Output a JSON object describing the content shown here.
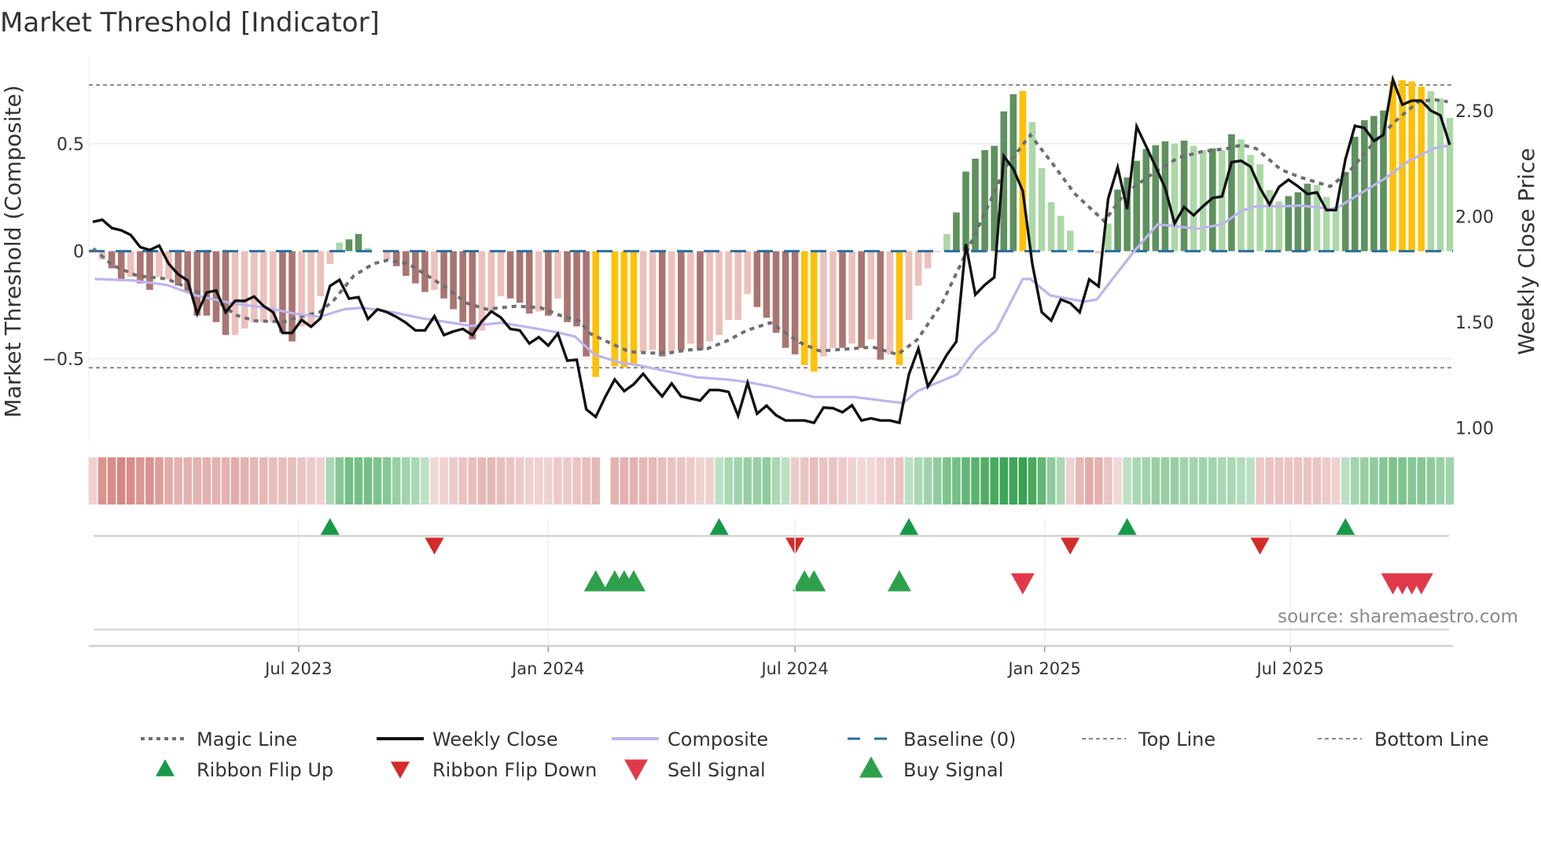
{
  "chart_data": {
    "type": "bar",
    "title": "Market Threshold [Indicator]",
    "ylabel": "Market Threshold (Composite)",
    "y2label": "Weekly Close Price",
    "xlabel": "",
    "ylim": [
      -0.886,
      0.872
    ],
    "y2lim": [
      0.935,
      2.722
    ],
    "yticks": [
      {
        "v": 0.5,
        "label": "0.5"
      },
      {
        "v": 0,
        "label": "0"
      },
      {
        "v": -0.5,
        "label": "−0.5"
      }
    ],
    "y2ticks": [
      {
        "v": 2.5,
        "label": "2.50"
      },
      {
        "v": 2.0,
        "label": "2.00"
      },
      {
        "v": 1.5,
        "label": "1.50"
      },
      {
        "v": 1.0,
        "label": "1.00"
      }
    ],
    "x_unit": "week index",
    "n_weeks": 144,
    "xticks": [
      {
        "week": 21.7,
        "label": "Jul 2023"
      },
      {
        "week": 48.0,
        "label": "Jan 2024"
      },
      {
        "week": 74.0,
        "label": "Jul 2024"
      },
      {
        "week": 100.3,
        "label": "Jan 2025"
      },
      {
        "week": 126.2,
        "label": "Jul 2025"
      }
    ],
    "top_line": 0.773,
    "bottom_line": -0.542,
    "baseline": 0,
    "grid": true,
    "legend_placement": "bottom",
    "histogram": {
      "values": [
        0.01,
        -0.04,
        -0.08,
        -0.13,
        -0.12,
        -0.15,
        -0.18,
        -0.12,
        -0.13,
        -0.16,
        -0.19,
        -0.3,
        -0.3,
        -0.33,
        -0.39,
        -0.39,
        -0.36,
        -0.33,
        -0.33,
        -0.33,
        -0.38,
        -0.42,
        -0.35,
        -0.35,
        -0.21,
        -0.06,
        0.04,
        0.055,
        0.08,
        0.015,
        0,
        -0.04,
        -0.07,
        -0.115,
        -0.15,
        -0.19,
        -0.18,
        -0.22,
        -0.27,
        -0.33,
        -0.41,
        -0.37,
        -0.29,
        -0.21,
        -0.22,
        -0.24,
        -0.29,
        -0.28,
        -0.3,
        -0.22,
        -0.33,
        -0.35,
        -0.49,
        -0.585,
        0,
        -0.535,
        -0.54,
        -0.53,
        -0.47,
        -0.46,
        -0.49,
        -0.465,
        -0.46,
        -0.43,
        -0.46,
        -0.42,
        -0.39,
        -0.32,
        -0.32,
        -0.2,
        -0.26,
        -0.31,
        -0.38,
        -0.45,
        -0.48,
        -0.53,
        -0.56,
        -0.49,
        -0.45,
        -0.45,
        -0.43,
        -0.45,
        -0.41,
        -0.505,
        -0.48,
        -0.53,
        -0.32,
        -0.16,
        -0.08,
        -0.005,
        0.08,
        0.18,
        0.37,
        0.43,
        0.47,
        0.49,
        0.65,
        0.73,
        0.745,
        0.6,
        0.386,
        0.228,
        0.164,
        0.095,
        0.006,
        0.003,
        -0.01,
        0.128,
        0.286,
        0.343,
        0.42,
        0.475,
        0.493,
        0.511,
        0.5,
        0.514,
        0.49,
        0.47,
        0.478,
        0.47,
        0.544,
        0.52,
        0.447,
        0.404,
        0.284,
        0.231,
        0.256,
        0.274,
        0.314,
        0.308,
        0.252,
        0.207,
        0.368,
        0.532,
        0.609,
        0.629,
        0.654,
        0.789,
        0.795,
        0.789,
        0.765,
        0.743,
        0.71,
        0.62
      ],
      "states": [
        "g",
        "r",
        "R",
        "R",
        "r",
        "R",
        "R",
        "r",
        "r",
        "R",
        "R",
        "R",
        "R",
        "R",
        "R",
        "r",
        "r",
        "r",
        "r",
        "r",
        "R",
        "R",
        "r",
        "r",
        "r",
        "r",
        "g",
        "G",
        "G",
        "g",
        "",
        "r",
        "R",
        "R",
        "R",
        "R",
        "r",
        "R",
        "R",
        "R",
        "R",
        "r",
        "r",
        "r",
        "R",
        "R",
        "R",
        "r",
        "R",
        "r",
        "R",
        "R",
        "R",
        "Y",
        "",
        "Y",
        "Y",
        "Y",
        "r",
        "r",
        "R",
        "r",
        "R",
        "r",
        "R",
        "r",
        "r",
        "r",
        "r",
        "r",
        "R",
        "R",
        "R",
        "R",
        "R",
        "Y",
        "Y",
        "r",
        "r",
        "R",
        "r",
        "R",
        "r",
        "R",
        "r",
        "Y",
        "r",
        "r",
        "r",
        "r",
        "g",
        "G",
        "G",
        "G",
        "G",
        "G",
        "G",
        "G",
        "Y",
        "g",
        "g",
        "g",
        "g",
        "g",
        "g",
        "g",
        "r",
        "g",
        "G",
        "G",
        "G",
        "G",
        "G",
        "G",
        "g",
        "G",
        "g",
        "g",
        "G",
        "g",
        "G",
        "g",
        "g",
        "g",
        "g",
        "g",
        "G",
        "G",
        "G",
        "g",
        "g",
        "g",
        "G",
        "G",
        "G",
        "G",
        "G",
        "Y",
        "Y",
        "Y",
        "Y",
        "g",
        "g",
        "g"
      ]
    },
    "weekly_close": [
      1.974,
      1.984,
      1.945,
      1.934,
      1.912,
      1.855,
      1.841,
      1.862,
      1.776,
      1.726,
      1.697,
      1.54,
      1.64,
      1.65,
      1.547,
      1.601,
      1.6,
      1.621,
      1.576,
      1.547,
      1.449,
      1.449,
      1.511,
      1.478,
      1.518,
      1.671,
      1.7,
      1.611,
      1.618,
      1.515,
      1.561,
      1.547,
      1.525,
      1.497,
      1.461,
      1.461,
      1.528,
      1.439,
      1.456,
      1.468,
      1.439,
      1.504,
      1.551,
      1.522,
      1.468,
      1.461,
      1.399,
      1.429,
      1.389,
      1.446,
      1.318,
      1.322,
      1.088,
      1.052,
      1.146,
      1.229,
      1.174,
      1.206,
      1.256,
      1.2,
      1.149,
      1.21,
      1.149,
      1.139,
      1.129,
      1.179,
      1.179,
      1.17,
      1.057,
      1.213,
      1.067,
      1.105,
      1.06,
      1.035,
      1.035,
      1.035,
      1.024,
      1.096,
      1.093,
      1.074,
      1.107,
      1.035,
      1.045,
      1.035,
      1.035,
      1.024,
      1.253,
      1.375,
      1.196,
      1.267,
      1.346,
      1.408,
      1.869,
      1.63,
      1.676,
      1.712,
      2.285,
      2.225,
      2.12,
      1.776,
      1.547,
      1.507,
      1.607,
      1.59,
      1.547,
      1.702,
      1.669,
      2.084,
      2.232,
      2.034,
      2.425,
      2.331,
      2.235,
      2.134,
      1.967,
      2.044,
      2.005,
      2.048,
      2.087,
      2.094,
      2.256,
      2.263,
      2.235,
      2.134,
      2.056,
      2.139,
      2.173,
      2.142,
      2.106,
      2.113,
      2.03,
      2.03,
      2.27,
      2.428,
      2.418,
      2.357,
      2.385,
      2.647,
      2.528,
      2.547,
      2.547,
      2.5,
      2.478,
      2.338
    ],
    "composite": [
      [
        0.2,
        1.704
      ],
      [
        4.2,
        1.697
      ],
      [
        7.8,
        1.676
      ],
      [
        10.9,
        1.626
      ],
      [
        14.6,
        1.59
      ],
      [
        18.2,
        1.568
      ],
      [
        21.3,
        1.54
      ],
      [
        23.9,
        1.525
      ],
      [
        26.5,
        1.561
      ],
      [
        28.5,
        1.568
      ],
      [
        31.6,
        1.547
      ],
      [
        34.7,
        1.518
      ],
      [
        36.8,
        1.504
      ],
      [
        39.9,
        1.482
      ],
      [
        43.0,
        1.497
      ],
      [
        45.1,
        1.482
      ],
      [
        48.7,
        1.454
      ],
      [
        50.8,
        1.432
      ],
      [
        52.9,
        1.346
      ],
      [
        55.4,
        1.311
      ],
      [
        57.5,
        1.296
      ],
      [
        60.6,
        1.267
      ],
      [
        63.7,
        1.239
      ],
      [
        66.8,
        1.229
      ],
      [
        68.9,
        1.217
      ],
      [
        71.4,
        1.196
      ],
      [
        76.0,
        1.146
      ],
      [
        80.2,
        1.146
      ],
      [
        85.4,
        1.117
      ],
      [
        86.9,
        1.174
      ],
      [
        91.1,
        1.253
      ],
      [
        93.1,
        1.375
      ],
      [
        95.2,
        1.461
      ],
      [
        98.0,
        1.704
      ],
      [
        98.8,
        1.704
      ],
      [
        100.9,
        1.626
      ],
      [
        104.5,
        1.597
      ],
      [
        105.8,
        1.607
      ],
      [
        107.6,
        1.712
      ],
      [
        109.7,
        1.833
      ],
      [
        112.2,
        1.962
      ],
      [
        113.8,
        1.955
      ],
      [
        116.4,
        1.941
      ],
      [
        119.0,
        1.962
      ],
      [
        121.1,
        2.027
      ],
      [
        122.6,
        2.048
      ],
      [
        125.2,
        2.048
      ],
      [
        127.3,
        2.051
      ],
      [
        130.9,
        2.034
      ],
      [
        133.5,
        2.106
      ],
      [
        136.1,
        2.177
      ],
      [
        138.7,
        2.263
      ],
      [
        141.3,
        2.321
      ],
      [
        142.8,
        2.335
      ]
    ],
    "magic_line": [
      [
        0.06,
        0.012
      ],
      [
        2.1,
        -0.066
      ],
      [
        4.7,
        -0.115
      ],
      [
        7.8,
        -0.129
      ],
      [
        10.4,
        -0.178
      ],
      [
        13.0,
        -0.228
      ],
      [
        15.1,
        -0.298
      ],
      [
        17.1,
        -0.324
      ],
      [
        20.2,
        -0.329
      ],
      [
        21.8,
        -0.305
      ],
      [
        23.9,
        -0.284
      ],
      [
        25.4,
        -0.228
      ],
      [
        27.5,
        -0.115
      ],
      [
        29.6,
        -0.058
      ],
      [
        31.1,
        -0.042
      ],
      [
        33.2,
        -0.058
      ],
      [
        35.3,
        -0.115
      ],
      [
        37.3,
        -0.171
      ],
      [
        39.4,
        -0.242
      ],
      [
        41.5,
        -0.27
      ],
      [
        44.6,
        -0.256
      ],
      [
        47.2,
        -0.263
      ],
      [
        49.2,
        -0.298
      ],
      [
        51.3,
        -0.326
      ],
      [
        52.4,
        -0.383
      ],
      [
        54.4,
        -0.425
      ],
      [
        56.5,
        -0.467
      ],
      [
        58.6,
        -0.474
      ],
      [
        60.6,
        -0.474
      ],
      [
        62.7,
        -0.46
      ],
      [
        64.8,
        -0.453
      ],
      [
        66.8,
        -0.418
      ],
      [
        68.9,
        -0.369
      ],
      [
        71.4,
        -0.333
      ],
      [
        74.5,
        -0.425
      ],
      [
        76.6,
        -0.464
      ],
      [
        80.2,
        -0.453
      ],
      [
        82.2,
        -0.446
      ],
      [
        84.8,
        -0.481
      ],
      [
        86.9,
        -0.411
      ],
      [
        89.5,
        -0.242
      ],
      [
        92.1,
        -0.002
      ],
      [
        94.2,
        0.195
      ],
      [
        96.2,
        0.392
      ],
      [
        98.8,
        0.54
      ],
      [
        100.9,
        0.421
      ],
      [
        103.5,
        0.266
      ],
      [
        106.6,
        0.139
      ],
      [
        108.7,
        0.266
      ],
      [
        111.8,
        0.364
      ],
      [
        114.4,
        0.435
      ],
      [
        116.9,
        0.463
      ],
      [
        119.5,
        0.477
      ],
      [
        121.1,
        0.494
      ],
      [
        122.6,
        0.477
      ],
      [
        125.2,
        0.379
      ],
      [
        127.3,
        0.343
      ],
      [
        130.4,
        0.301
      ],
      [
        132.4,
        0.371
      ],
      [
        135.0,
        0.505
      ],
      [
        137.6,
        0.618
      ],
      [
        139.7,
        0.695
      ],
      [
        141.3,
        0.705
      ],
      [
        142.8,
        0.695
      ]
    ],
    "ribbon": [
      -0.2,
      -0.7,
      -0.75,
      -0.8,
      -0.75,
      -0.65,
      -0.7,
      -0.6,
      -0.5,
      -0.45,
      -0.45,
      -0.45,
      -0.45,
      -0.45,
      -0.45,
      -0.5,
      -0.45,
      -0.4,
      -0.4,
      -0.35,
      -0.35,
      -0.35,
      -0.3,
      -0.25,
      -0.2,
      0.3,
      0.5,
      0.6,
      0.6,
      0.6,
      0.55,
      0.5,
      0.4,
      0.35,
      0.3,
      0.2,
      -0.15,
      -0.2,
      -0.25,
      -0.3,
      -0.35,
      -0.4,
      -0.4,
      -0.35,
      -0.3,
      -0.25,
      -0.2,
      -0.2,
      -0.2,
      -0.25,
      -0.25,
      -0.3,
      -0.35,
      -0.4,
      null,
      -0.45,
      -0.45,
      -0.45,
      -0.4,
      -0.4,
      -0.35,
      -0.3,
      -0.3,
      -0.25,
      -0.2,
      -0.2,
      0.2,
      0.3,
      0.35,
      0.4,
      0.4,
      0.45,
      0.3,
      0.2,
      -0.25,
      -0.3,
      -0.35,
      -0.3,
      -0.3,
      -0.25,
      -0.2,
      -0.15,
      -0.15,
      -0.2,
      -0.25,
      -0.3,
      0.2,
      0.3,
      0.35,
      0.45,
      0.55,
      0.6,
      0.7,
      0.75,
      0.8,
      0.85,
      0.9,
      0.9,
      0.95,
      0.85,
      0.7,
      0.45,
      0.3,
      -0.2,
      -0.4,
      -0.5,
      -0.45,
      -0.3,
      -0.15,
      0.2,
      0.3,
      0.35,
      0.4,
      0.4,
      0.4,
      0.35,
      0.35,
      0.35,
      0.35,
      0.3,
      0.3,
      0.25,
      0.2,
      -0.25,
      -0.3,
      -0.3,
      -0.3,
      -0.3,
      -0.3,
      -0.3,
      -0.25,
      -0.2,
      0.2,
      0.35,
      0.4,
      0.45,
      0.5,
      0.55,
      0.55,
      0.5,
      0.5,
      0.45,
      0.4,
      0.35
    ],
    "signals": {
      "ribbon_flip_up": [
        25,
        66,
        86,
        109,
        132
      ],
      "ribbon_flip_down": [
        36,
        74,
        103,
        123
      ],
      "buy": [
        53,
        55,
        56,
        57,
        75,
        76,
        85
      ],
      "sell": [
        98,
        137,
        138,
        139,
        140
      ]
    },
    "legend": [
      {
        "key": "magic",
        "label": "Magic Line"
      },
      {
        "key": "close",
        "label": "Weekly Close"
      },
      {
        "key": "composite",
        "label": "Composite"
      },
      {
        "key": "baseline",
        "label": "Baseline (0)"
      },
      {
        "key": "top",
        "label": "Top Line"
      },
      {
        "key": "bottom",
        "label": "Bottom Line"
      },
      {
        "key": "flip_up",
        "label": "Ribbon Flip Up"
      },
      {
        "key": "flip_down",
        "label": "Ribbon Flip Down"
      },
      {
        "key": "sell",
        "label": "Sell Signal"
      },
      {
        "key": "buy",
        "label": "Buy Signal"
      }
    ],
    "source": "source: sharemaestro.com",
    "colors": {
      "G": "#5e915e",
      "g": "#acd8a7",
      "R": "#a97571",
      "r": "#ecc0bb",
      "Y": "#ffc107",
      "close": "#111111",
      "composite": "#bdb5ec",
      "magic": "#6e6e72",
      "baseline": "#2a6f9e",
      "threshold": "#888888",
      "ribbon_red": "#cc6e6a",
      "ribbon_green": "#2e9e47",
      "flip_up": "#17994a",
      "flip_down": "#d42a2a",
      "buy": "#2ea04c",
      "sell": "#e03a4a"
    }
  }
}
